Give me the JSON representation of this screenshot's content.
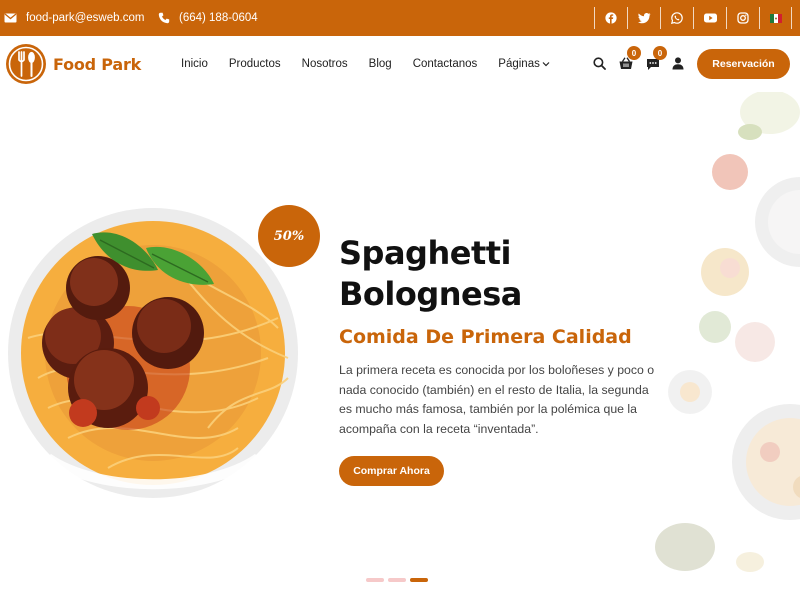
{
  "topbar": {
    "email": "food-park@esweb.com",
    "phone": "(664) 188-0604",
    "socials": [
      "facebook-icon",
      "twitter-icon",
      "whatsapp-icon",
      "youtube-icon",
      "instagram-icon",
      "mexico-flag-icon"
    ]
  },
  "navbar": {
    "brand": "Food Park",
    "menu": [
      "Inicio",
      "Productos",
      "Nosotros",
      "Blog",
      "Contactanos",
      "Páginas"
    ],
    "cart_count": "0",
    "messages_count": "0",
    "reserve_label": "Reservación"
  },
  "hero": {
    "discount": "50%",
    "title": "Spaghetti Bolognesa",
    "subtitle": "Comida De Primera Calidad",
    "description": "La primera receta es conocida por los boloñeses y poco o nada conocido (también) en el resto de Italia, la segunda es mucho más famosa, también por la polémica que la acompaña con la receta “inventada”.",
    "cta_label": "Comprar Ahora",
    "slides": 3,
    "active_slide": 3
  },
  "colors": {
    "accent": "#c9650a",
    "dot_inactive": "#f6c9c9"
  }
}
